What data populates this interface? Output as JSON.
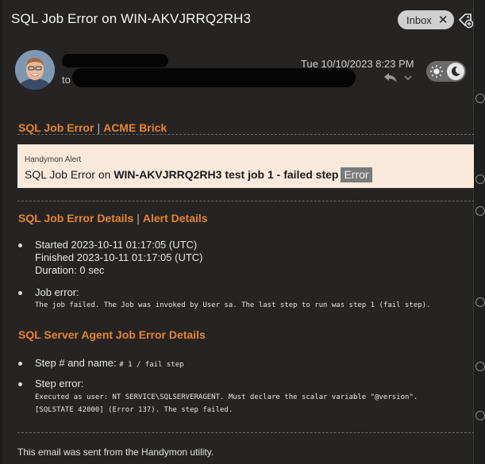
{
  "subject": "SQL Job Error on WIN-AKVJRRQ2RH3",
  "folder_chip": {
    "label": "Inbox",
    "close": "✕"
  },
  "header": {
    "to_label": "to",
    "datetime": "Tue 10/10/2023 8:23 PM"
  },
  "body": {
    "title_link": "SQL Job Error",
    "title_sep": "|",
    "title_company": "ACME Brick",
    "alert": {
      "label": "Handymon Alert",
      "prefix": "SQL Job Error on ",
      "detail": "WIN-AKVJRRQ2RH3 test job 1 - failed step",
      "badge": "Error"
    },
    "details_heading": "SQL Job Error Details",
    "details_sep": "|",
    "details_link": "Alert Details",
    "started": "Started 2023-10-11 01:17:05 (UTC)",
    "finished": "Finished 2023-10-11 01:17:05 (UTC)",
    "duration": "Duration: 0 sec",
    "job_error_label": "Job error:",
    "job_error_text": "The job failed. The Job was invoked by User sa. The last step to run was step 1 (fail step).",
    "agent_heading": "SQL Server Agent Job Error Details",
    "step_label": "Step # and name:",
    "step_value": "# 1 / fail step",
    "step_error_label": "Step error:",
    "step_error_line1": "Executed as user: NT SERVICE\\SQLSERVERAGENT. Must declare the scalar variable \"@version\".",
    "step_error_line2": "[SQLSTATE 42000] (Error 137). The step failed.",
    "footer": "This email was sent from the Handymon utility."
  },
  "colors": {
    "accent": "#e8842c",
    "alert_bg": "#fbeadc",
    "panel": "#252423"
  },
  "icons": [
    "tag-add-icon",
    "reply-icon",
    "chevron-down-icon",
    "sun-icon",
    "moon-icon"
  ]
}
